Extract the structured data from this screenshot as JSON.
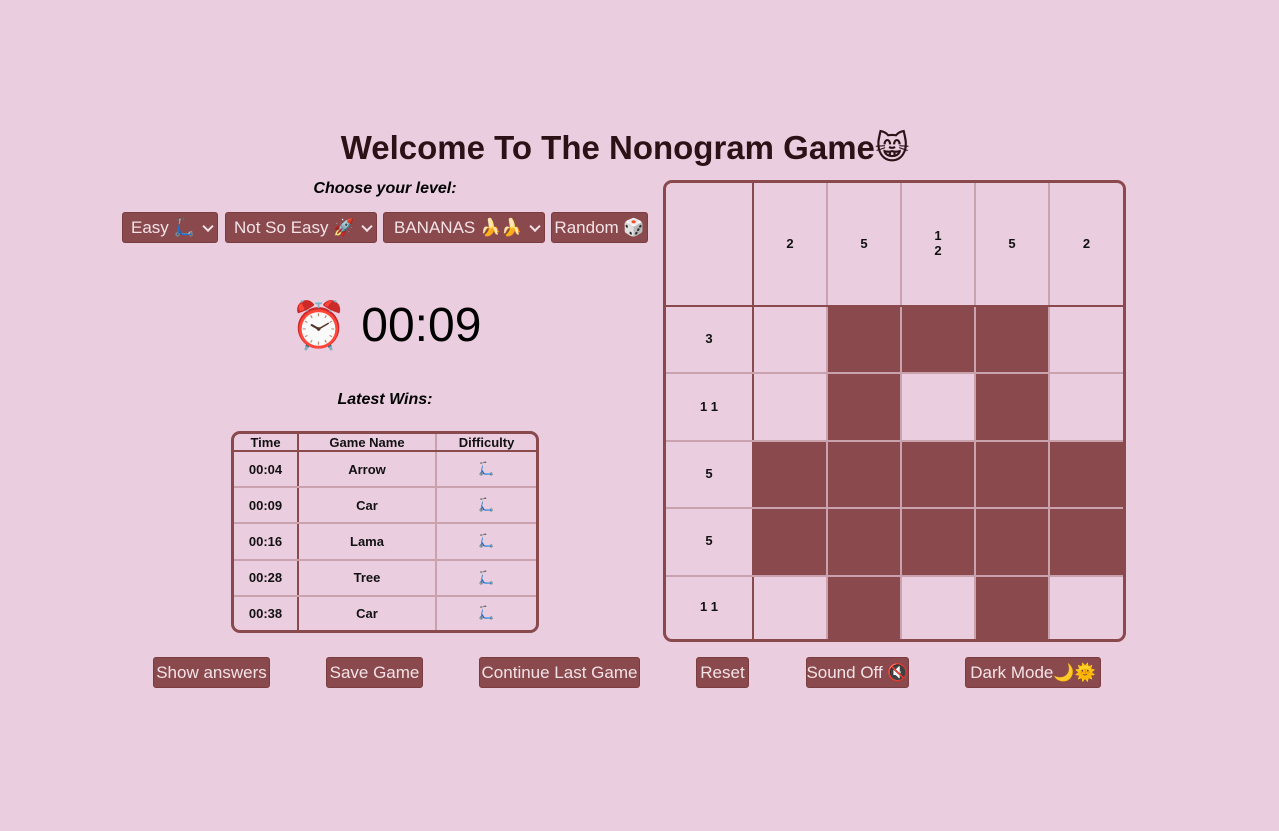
{
  "title": "Welcome To The Nonogram Game😸",
  "level": {
    "label": "Choose your level:",
    "selects": [
      {
        "value": "Easy 🛴"
      },
      {
        "value": "Not So Easy 🚀"
      },
      {
        "value": "BANANAS 🍌🍌"
      }
    ],
    "random_label": "Random 🎲"
  },
  "timer": {
    "icon": "⏰",
    "value": "00:09"
  },
  "wins": {
    "label": "Latest Wins:",
    "headers": [
      "Time",
      "Game Name",
      "Difficulty"
    ],
    "rows": [
      {
        "time": "00:04",
        "name": "Arrow",
        "difficulty": "🛴"
      },
      {
        "time": "00:09",
        "name": "Car",
        "difficulty": "🛴"
      },
      {
        "time": "00:16",
        "name": "Lama",
        "difficulty": "🛴"
      },
      {
        "time": "00:28",
        "name": "Tree",
        "difficulty": "🛴"
      },
      {
        "time": "00:38",
        "name": "Car",
        "difficulty": "🛴"
      }
    ]
  },
  "board": {
    "column_clues": [
      [
        "2"
      ],
      [
        "5"
      ],
      [
        "1",
        "2"
      ],
      [
        "5"
      ],
      [
        "2"
      ]
    ],
    "row_clues": [
      "3",
      "1 1",
      "5",
      "5",
      "1 1"
    ],
    "cells": [
      [
        0,
        1,
        1,
        1,
        0
      ],
      [
        0,
        1,
        0,
        1,
        0
      ],
      [
        1,
        1,
        1,
        1,
        1
      ],
      [
        1,
        1,
        1,
        1,
        1
      ],
      [
        0,
        1,
        0,
        1,
        0
      ]
    ],
    "filled_color": "#8a4a4d"
  },
  "actions": {
    "show_answers": "Show answers",
    "save_game": "Save Game",
    "continue_last_game": "Continue Last Game",
    "reset": "Reset",
    "sound": "Sound Off 🔇",
    "dark_mode": "Dark Mode🌙🌞"
  },
  "colors": {
    "background": "#ebcde0",
    "accent": "#8a4a4d",
    "grid_line": "#c9a2ad"
  }
}
